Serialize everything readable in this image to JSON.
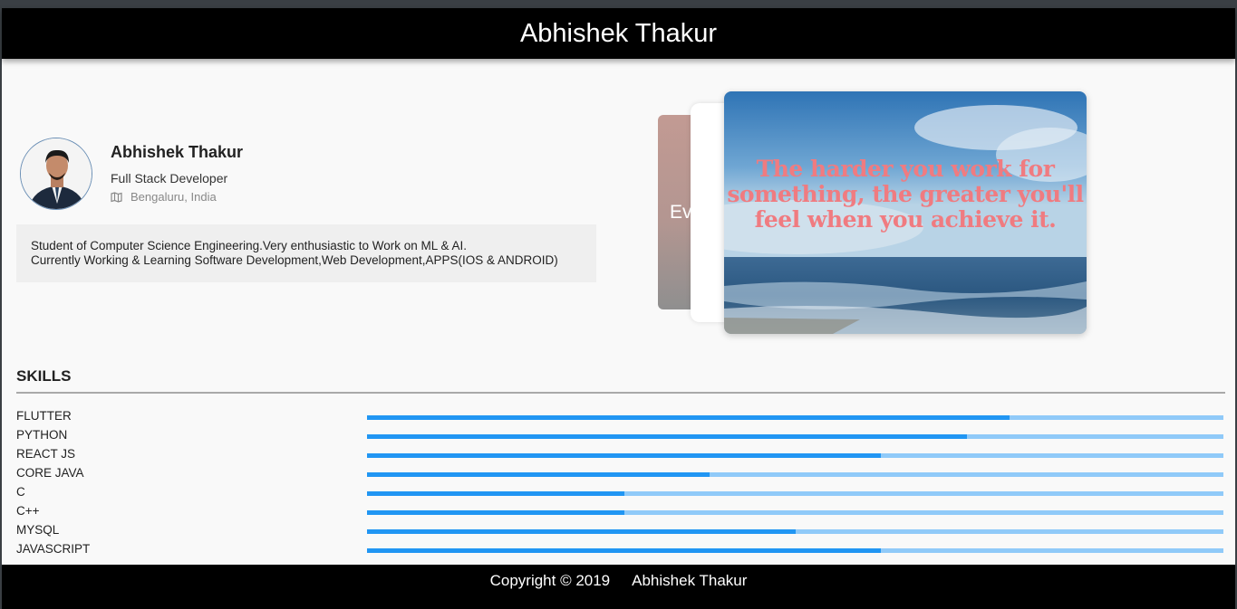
{
  "header": {
    "title": "Abhishek Thakur"
  },
  "profile": {
    "name": "Abhishek Thakur",
    "role": "Full Stack Developer",
    "location": "Bengaluru, India",
    "location_icon": "map-icon",
    "bio_line1": "Student of Computer Science Engineering.Very enthusiastic to Work on ML & AI.",
    "bio_line2": "Currently Working & Learning Software Development,Web Development,APPS(IOS & ANDROID)"
  },
  "carousel": {
    "back_card_text": "Eve",
    "front_quote": "The harder you work for something, the greater you'll feel when you achieve it."
  },
  "skills": {
    "title": "SKILLS",
    "items": [
      {
        "label": "FLUTTER",
        "level": 0.75
      },
      {
        "label": "PYTHON",
        "level": 0.7
      },
      {
        "label": "REACT JS",
        "level": 0.6
      },
      {
        "label": "CORE JAVA",
        "level": 0.4
      },
      {
        "label": "C",
        "level": 0.3
      },
      {
        "label": "C++",
        "level": 0.3
      },
      {
        "label": "MYSQL",
        "level": 0.5
      },
      {
        "label": "JAVASCRIPT",
        "level": 0.6
      }
    ],
    "fill_color": "#2196f3",
    "track_color": "#90caf9"
  },
  "footer": {
    "copyright": "Copyright © 2019",
    "author": "Abhishek Thakur"
  }
}
